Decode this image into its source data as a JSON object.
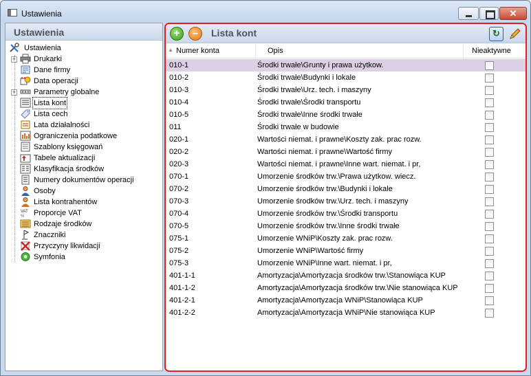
{
  "window": {
    "title": "Ustawienia"
  },
  "left_panel": {
    "header": "Ustawienia",
    "tree": [
      {
        "label": "Ustawienia",
        "icon": "tools-icon",
        "root": true
      },
      {
        "label": "Drukarki",
        "icon": "printer-icon",
        "expandable": true
      },
      {
        "label": "Dane firmy",
        "icon": "company-icon"
      },
      {
        "label": "Data operacji",
        "icon": "calendar-icon"
      },
      {
        "label": "Parametry globalne",
        "icon": "parameters-icon",
        "expandable": true
      },
      {
        "label": "Lista kont",
        "icon": "accounts-list-icon",
        "selected": true
      },
      {
        "label": "Lista cech",
        "icon": "tag-icon"
      },
      {
        "label": "Lata działalności",
        "icon": "years-icon"
      },
      {
        "label": "Ograniczenia podatkowe",
        "icon": "tax-limits-icon"
      },
      {
        "label": "Szablony księgowań",
        "icon": "templates-icon"
      },
      {
        "label": "Tabele aktualizacji",
        "icon": "update-tables-icon"
      },
      {
        "label": "Klasyfikacja środków",
        "icon": "classification-icon"
      },
      {
        "label": "Numery dokumentów operacji",
        "icon": "document-numbers-icon"
      },
      {
        "label": "Osoby",
        "icon": "person-icon"
      },
      {
        "label": "Lista kontrahentów",
        "icon": "contractors-icon"
      },
      {
        "label": "Proporcje VAT",
        "icon": "vat-icon"
      },
      {
        "label": "Rodzaje środków",
        "icon": "asset-types-icon"
      },
      {
        "label": "Znaczniki",
        "icon": "markers-icon"
      },
      {
        "label": "Przyczyny likwidacji",
        "icon": "liquidation-icon"
      },
      {
        "label": "Symfonia",
        "icon": "symfonia-icon"
      }
    ]
  },
  "list": {
    "title": "Lista kont",
    "columns": {
      "number": "Numer konta",
      "description": "Opis",
      "inactive": "Nieaktywne"
    },
    "rows": [
      {
        "number": "010-1",
        "description": "Środki trwałe\\Grunty i prawa użytkow.",
        "selected": true
      },
      {
        "number": "010-2",
        "description": "Środki trwałe\\Budynki i lokale"
      },
      {
        "number": "010-3",
        "description": "Środki trwałe\\Urz. tech. i maszyny"
      },
      {
        "number": "010-4",
        "description": "Środki trwałe\\Środki transportu"
      },
      {
        "number": "010-5",
        "description": "Środki trwałe\\Inne środki trwałe"
      },
      {
        "number": "011",
        "description": "Środki trwałe w budowie"
      },
      {
        "number": "020-1",
        "description": "Wartości niemat. i prawne\\Koszty zak. prac rozw."
      },
      {
        "number": "020-2",
        "description": "Wartości niemat. i prawne\\Wartość firmy"
      },
      {
        "number": "020-3",
        "description": "Wartości niemat. i prawne\\Inne wart. niemat. i pr,"
      },
      {
        "number": "070-1",
        "description": "Umorzenie środków trw.\\Prawa użytkow. wiecz."
      },
      {
        "number": "070-2",
        "description": "Umorzenie środków trw.\\Budynki i lokale"
      },
      {
        "number": "070-3",
        "description": "Umorzenie środków trw.\\Urz. tech. i maszyny"
      },
      {
        "number": "070-4",
        "description": "Umorzenie środków trw.\\Środki transportu"
      },
      {
        "number": "070-5",
        "description": "Umorzenie środków trw.\\Inne środki trwałe"
      },
      {
        "number": "075-1",
        "description": "Umorzenie WNiP\\Koszty zak. prac rozw."
      },
      {
        "number": "075-2",
        "description": "Umorzenie WNiP\\Wartość firmy"
      },
      {
        "number": "075-3",
        "description": "Umorzenie WNiP\\Inne wart. niemat. i pr,"
      },
      {
        "number": "401-1-1",
        "description": "Amortyzacja\\Amortyzacja środków trw.\\Stanowiąca KUP"
      },
      {
        "number": "401-1-2",
        "description": "Amortyzacja\\Amortyzacja środków trw.\\Nie stanowiąca KUP"
      },
      {
        "number": "401-2-1",
        "description": "Amortyzacja\\Amortyzacja WNiP\\Stanowiąca KUP"
      },
      {
        "number": "401-2-2",
        "description": "Amortyzacja\\Amortyzacja WNiP\\Nie stanowiąca KUP"
      }
    ]
  }
}
